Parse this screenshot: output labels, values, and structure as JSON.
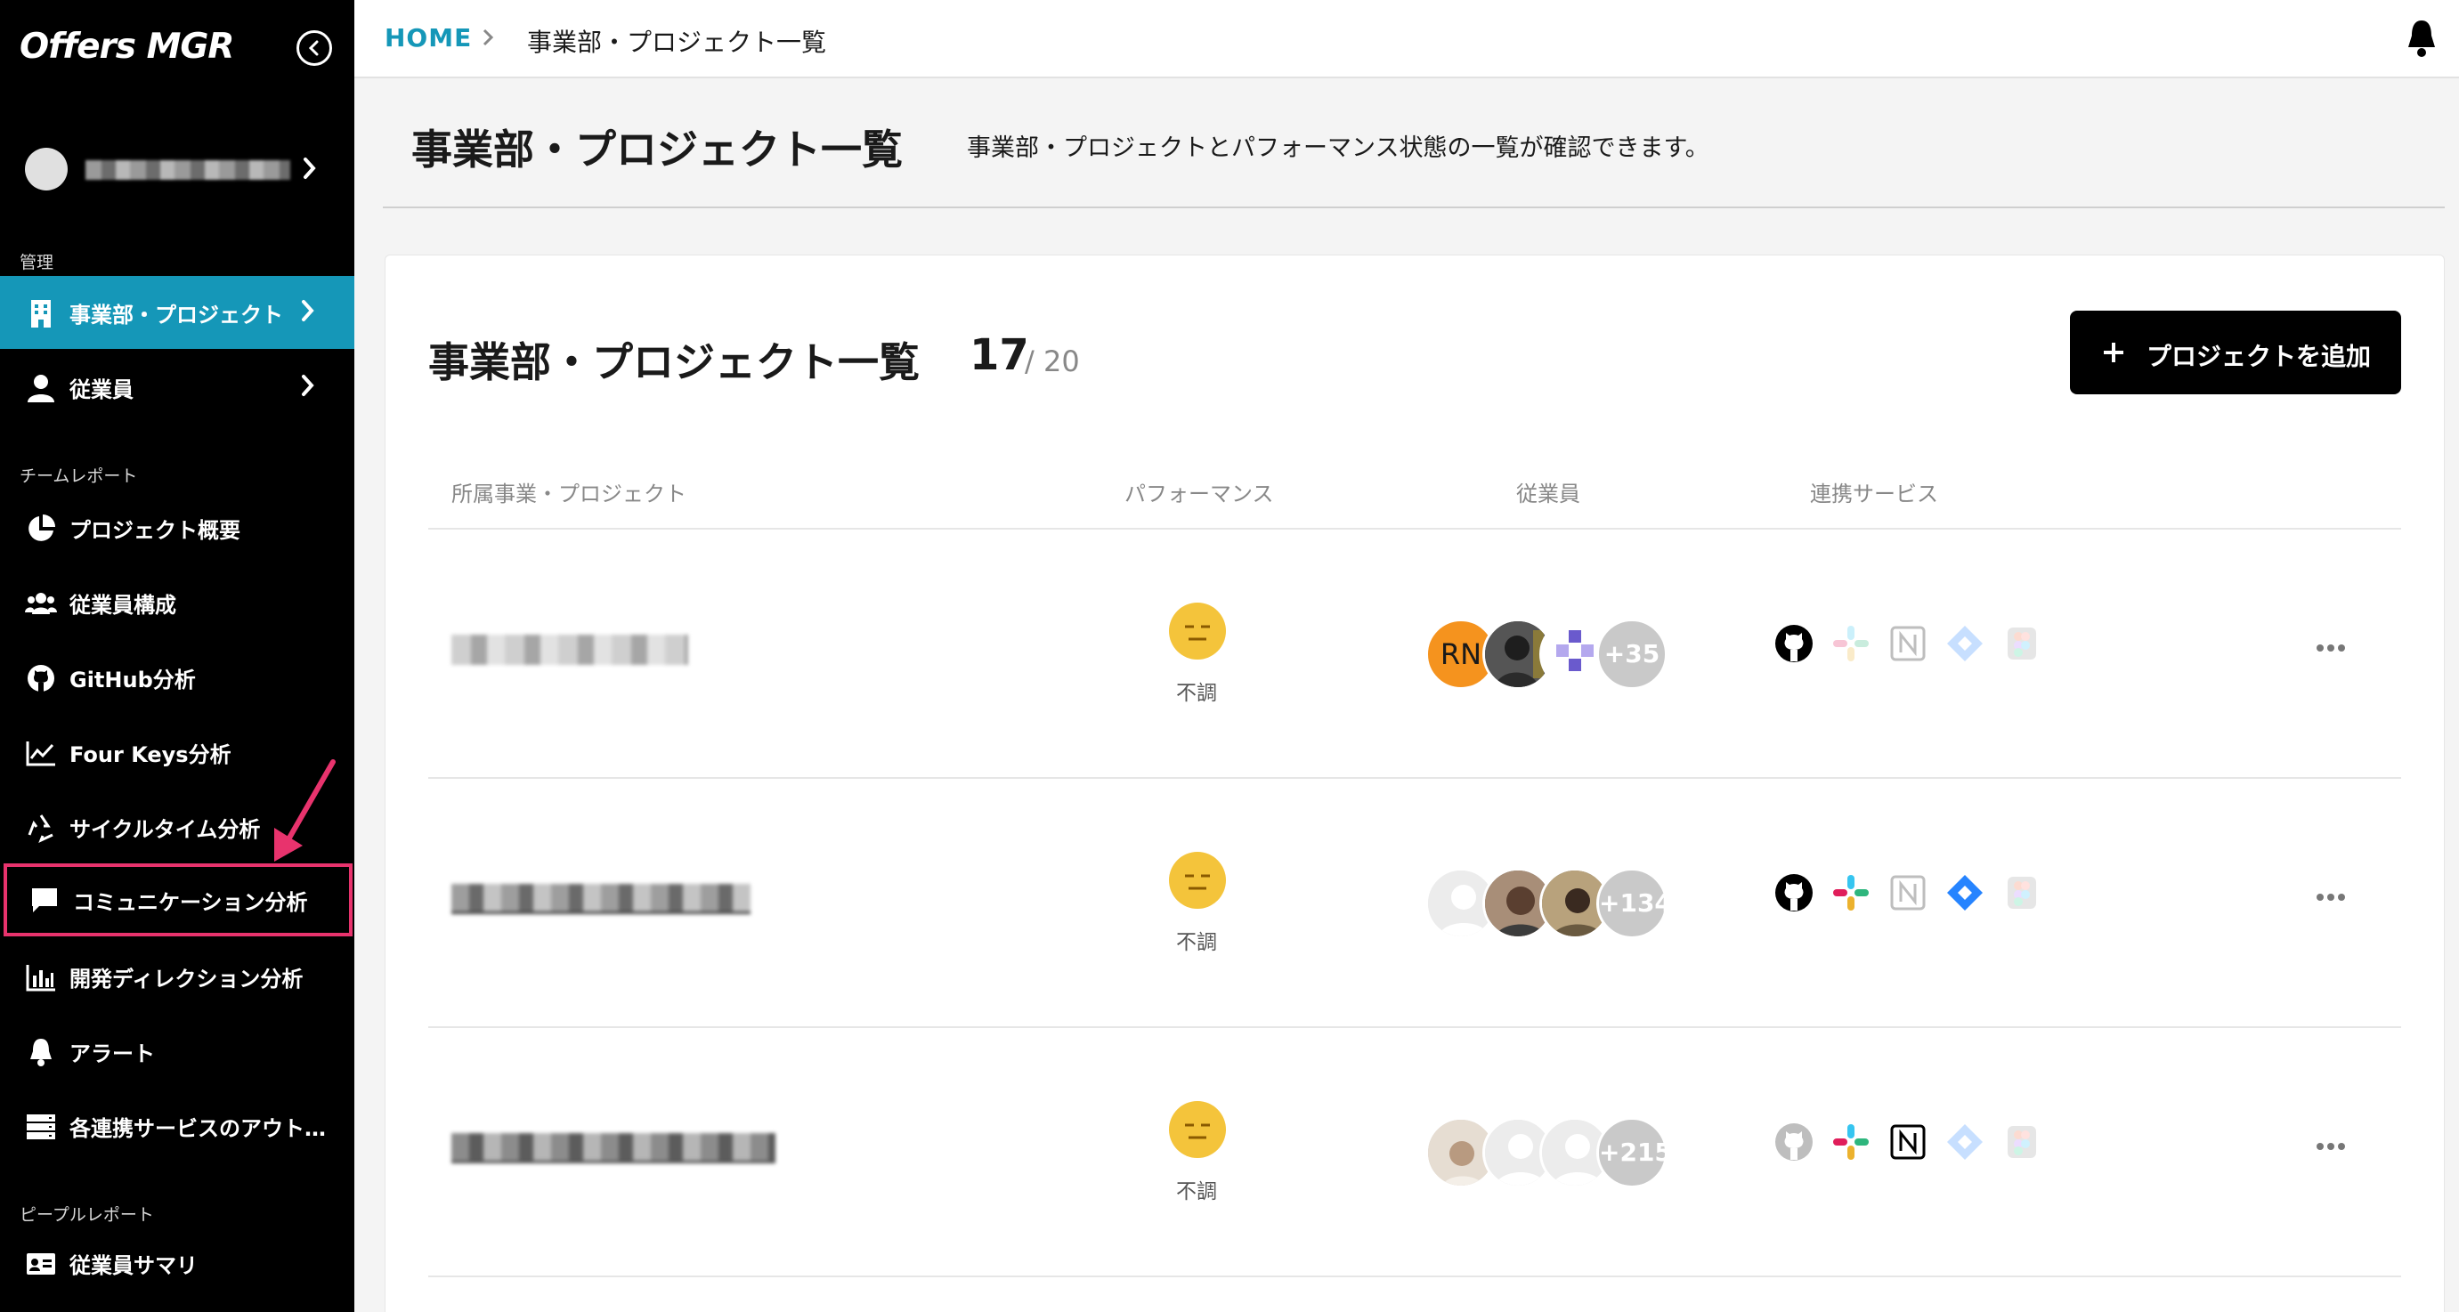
{
  "app": {
    "name": "Offers MGR"
  },
  "sidebar": {
    "sections": {
      "manage": "管理",
      "team_report": "チームレポート",
      "people_report": "ピープルレポート"
    },
    "items": [
      {
        "label": "事業部・プロジェクト",
        "icon": "building-icon",
        "active": true
      },
      {
        "label": "従業員",
        "icon": "person-icon"
      },
      {
        "label": "プロジェクト概要",
        "icon": "pie-chart-icon"
      },
      {
        "label": "従業員構成",
        "icon": "people-group-icon"
      },
      {
        "label": "GitHub分析",
        "icon": "github-icon"
      },
      {
        "label": "Four Keys分析",
        "icon": "line-chart-icon"
      },
      {
        "label": "サイクルタイム分析",
        "icon": "recycle-icon"
      },
      {
        "label": "コミュニケーション分析",
        "icon": "chat-bubble-icon",
        "highlighted": true
      },
      {
        "label": "開発ディレクション分析",
        "icon": "bar-chart-icon"
      },
      {
        "label": "アラート",
        "icon": "bell-icon"
      },
      {
        "label": "各連携サービスのアウト…",
        "icon": "server-icon"
      },
      {
        "label": "従業員サマリ",
        "icon": "id-card-icon"
      }
    ]
  },
  "breadcrumb": {
    "home": "HOME",
    "current": "事業部・プロジェクト一覧"
  },
  "page": {
    "title": "事業部・プロジェクト一覧",
    "description": "事業部・プロジェクトとパフォーマンス状態の一覧が確認できます。"
  },
  "card": {
    "title": "事業部・プロジェクト一覧",
    "count_current": "17",
    "count_max": "/ 20",
    "add_button": "プロジェクトを追加"
  },
  "table": {
    "headers": [
      "所属事業・プロジェクト",
      "パフォーマンス",
      "従業員",
      "連携サービス"
    ],
    "rows": [
      {
        "performance": "不調",
        "avatar_initials": "RN",
        "employee_more": "+35",
        "services": {
          "github": true,
          "slack": false,
          "notion": false,
          "jira": false,
          "figma": false
        }
      },
      {
        "performance": "不調",
        "avatar_initials": "",
        "employee_more": "+134",
        "services": {
          "github": true,
          "slack": true,
          "notion": false,
          "jira": true,
          "figma": false
        }
      },
      {
        "performance": "不調",
        "avatar_initials": "",
        "employee_more": "+215",
        "services": {
          "github": false,
          "slack": true,
          "notion": true,
          "jira": false,
          "figma": false
        }
      }
    ]
  },
  "colors": {
    "accent": "#1597b8",
    "highlight": "#e8336d",
    "performance_face": "#f4c43b"
  }
}
